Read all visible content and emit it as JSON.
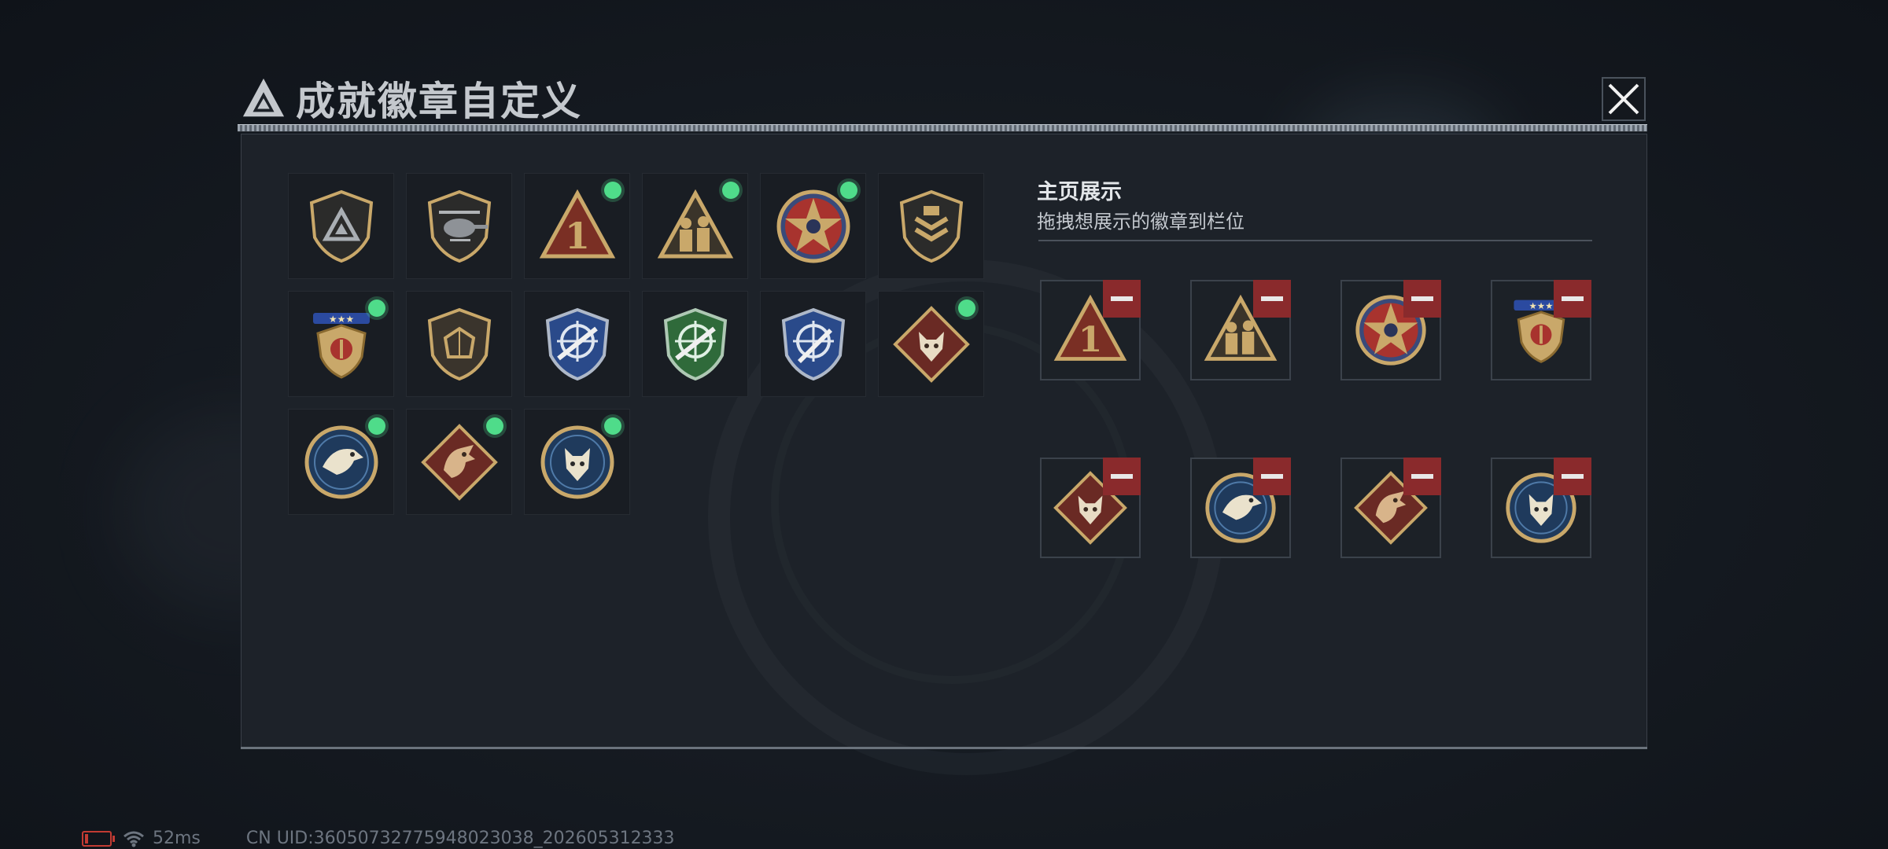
{
  "window": {
    "title": "成就徽章自定义",
    "close_icon": "close-icon"
  },
  "inventory": [
    {
      "icon": "triangle-shield-badge",
      "new": false
    },
    {
      "icon": "helicopter-shield-badge",
      "new": false
    },
    {
      "icon": "number-one-triangle-badge",
      "new": true
    },
    {
      "icon": "soldiers-triangle-badge",
      "new": true
    },
    {
      "icon": "star-emblem-badge",
      "new": true
    },
    {
      "icon": "chevron-shield-badge",
      "new": false
    },
    {
      "icon": "gold-winged-shield-badge",
      "new": true
    },
    {
      "icon": "dice-shield-badge",
      "new": false
    },
    {
      "icon": "blue-crosshair-rifle-badge",
      "new": false
    },
    {
      "icon": "green-crosshair-rifle-badge",
      "new": false
    },
    {
      "icon": "blue-crosshair-knife-badge",
      "new": false
    },
    {
      "icon": "wolf-diamond-badge",
      "new": true
    },
    {
      "icon": "eagle-round-badge",
      "new": true
    },
    {
      "icon": "dragon-diamond-badge",
      "new": true
    },
    {
      "icon": "wolf-round-badge",
      "new": true
    }
  ],
  "showcase": {
    "title": "主页展示",
    "subtitle": "拖拽想展示的徽章到栏位",
    "slots": [
      {
        "icon": "number-one-triangle-badge"
      },
      {
        "icon": "soldiers-triangle-badge"
      },
      {
        "icon": "star-emblem-badge"
      },
      {
        "icon": "gold-winged-shield-badge"
      },
      {
        "icon": "wolf-diamond-badge"
      },
      {
        "icon": "eagle-round-badge"
      },
      {
        "icon": "dragon-diamond-badge"
      },
      {
        "icon": "wolf-round-badge"
      }
    ]
  },
  "status_bar": {
    "battery_icon": "battery-low-icon",
    "wifi_icon": "wifi-icon",
    "ping": "52ms",
    "uid": "CN UID:36050732775948023038_202605312333"
  },
  "colors": {
    "new_dot": "#4fdc8a",
    "remove": "#8a2a2c",
    "gold": "#c9a86a"
  }
}
